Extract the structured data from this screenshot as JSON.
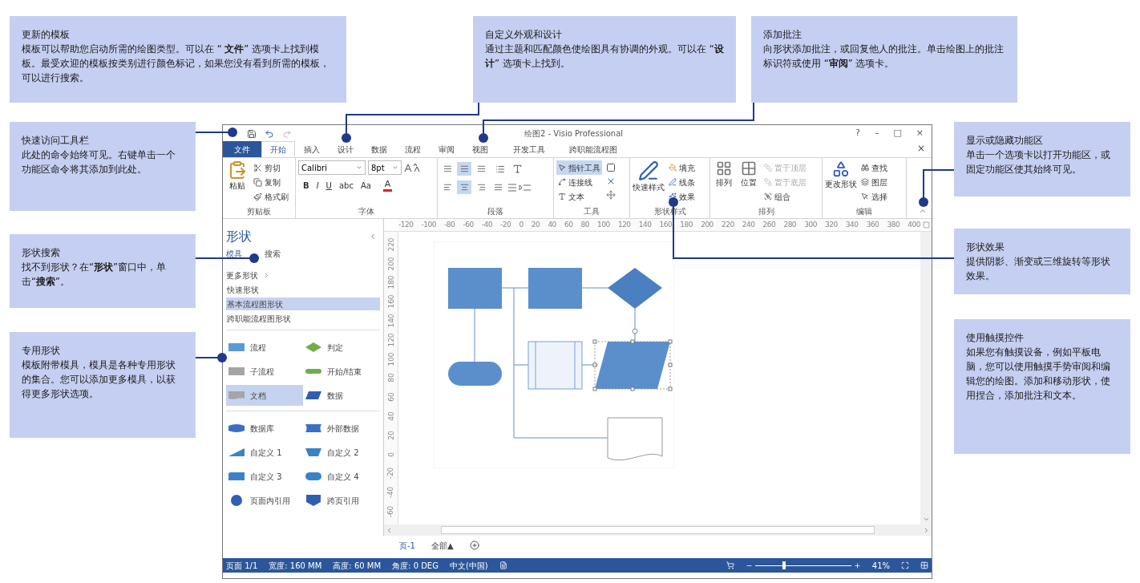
{
  "callouts_top": [
    {
      "title": "更新的模板",
      "body": "模板可以帮助您启动所需的绘图类型。可以在 “ **文件**” 选项卡上找到模板。最受欢迎的模板按类别进行颜色标记，如果您没有看到所需的模板，可以进行搜索。"
    },
    {
      "title": "自定义外观和设计",
      "body": "通过主题和匹配颜色使绘图具有协调的外观。可以在 “**设计**” 选项卡上找到。"
    },
    {
      "title": "添加批注",
      "body": "向形状添加批注，或回复他人的批注。单击绘图上的批注标识符或使用 “**审阅**” 选项卡。"
    }
  ],
  "callouts_left": [
    {
      "title": "快速访问工具栏",
      "body": "此处的命令始终可见。右键单击一个功能区命令将其添加到此处。"
    },
    {
      "title": "形状搜索",
      "body": "找不到形状？在“**形状**”窗口中，单击“**搜索**”。"
    },
    {
      "title": "专用形状",
      "body": "模板附带模具，模具是各种专用形状的集合。您可以添加更多模具，以获得更多形状选项。"
    }
  ],
  "callouts_right": [
    {
      "title": "显示或隐藏功能区",
      "body": "单击一个选项卡以打开功能区，或固定功能区使其始终可见。"
    },
    {
      "title": "形状效果",
      "body": "提供阴影、渐变或三维旋转等形状效果。"
    },
    {
      "title": "使用触摸控件",
      "body": "如果您有触摸设备，例如平板电脑，您可以使用触摸手势审阅和编辑您的绘图。添加和移动形状，使用捏合，添加批注和文本。"
    }
  ],
  "window": {
    "title": "绘图2 - Visio Professional",
    "controls": [
      "?",
      "–",
      "□",
      "×"
    ]
  },
  "ribbon_tabs": [
    {
      "label": "文件",
      "kind": "file",
      "selected": false
    },
    {
      "label": "开始",
      "kind": "tab",
      "selected": true
    },
    {
      "label": "插入",
      "kind": "tab",
      "selected": false
    },
    {
      "label": "设计",
      "kind": "tab",
      "selected": false
    },
    {
      "label": "数据",
      "kind": "tab",
      "selected": false
    },
    {
      "label": "流程",
      "kind": "tab",
      "selected": false
    },
    {
      "label": "审阅",
      "kind": "tab",
      "selected": false
    },
    {
      "label": "视图",
      "kind": "tab",
      "selected": false
    },
    {
      "label": "开发工具",
      "kind": "tab",
      "selected": false
    },
    {
      "label": "跨职能流程图",
      "kind": "tab",
      "selected": false
    }
  ],
  "ribbon_close": "×",
  "ribbon_groups": [
    {
      "kind": "clipboard",
      "label": "剪贴板",
      "paste": "粘贴",
      "items": [
        "剪切",
        "复制",
        "格式刷"
      ]
    },
    {
      "kind": "font",
      "label": "字体",
      "font": "Calibri",
      "size": "8pt",
      "buttons": [
        "B",
        "I",
        "U",
        "abc",
        "Aa"
      ],
      "font_color": "A"
    },
    {
      "kind": "paragraph",
      "label": "段落",
      "valign": [
        {
          "selected": false
        },
        {
          "selected": true
        },
        {
          "selected": false
        }
      ],
      "halign": [
        {
          "selected": false
        },
        {
          "selected": true
        },
        {
          "selected": false
        },
        {
          "selected": false
        }
      ]
    },
    {
      "kind": "tools",
      "label": "工具",
      "items": [
        {
          "label": "指针工具",
          "selected": true
        },
        {
          "label": "连接线",
          "selected": false
        },
        {
          "label": "文本",
          "selected": false
        }
      ]
    },
    {
      "kind": "shape_styles",
      "label": "形状样式",
      "quick": "快速样式",
      "items": [
        "填充",
        "线条",
        "效果"
      ]
    },
    {
      "kind": "arrange",
      "label": "排列",
      "big": [
        "排列",
        "位置"
      ],
      "items": [
        {
          "label": "置于顶层",
          "disabled": true
        },
        {
          "label": "置于底层",
          "disabled": true
        },
        {
          "label": "组合",
          "disabled": false
        }
      ]
    },
    {
      "kind": "editing",
      "label": "编辑",
      "big": "更改形状",
      "items": [
        "查找",
        "图层",
        "选择"
      ]
    }
  ],
  "shapes_panel": {
    "title": "形状",
    "tabs": [
      {
        "label": "模具",
        "selected": true
      },
      {
        "label": "搜索",
        "selected": false
      }
    ],
    "more": "更多形状",
    "stencils": [
      {
        "label": "快速形状",
        "selected": false
      },
      {
        "label": "基本流程图形状",
        "selected": true
      },
      {
        "label": "跨职能流程图形状",
        "selected": false
      }
    ],
    "sections": [
      [
        {
          "label": "流程",
          "kind": "process",
          "color": "#5b9bd5",
          "selected": false
        },
        {
          "label": "判定",
          "kind": "decision",
          "color": "#70ad47",
          "selected": false
        },
        {
          "label": "子流程",
          "kind": "subprocess",
          "color": "#a5a5a5",
          "selected": false
        },
        {
          "label": "开始/结束",
          "kind": "terminator",
          "color": "#70ad47",
          "selected": false
        },
        {
          "label": "文档",
          "kind": "document",
          "color": "#a5a5a5",
          "selected": true
        },
        {
          "label": "数据",
          "kind": "data",
          "color": "#2f5fb3",
          "selected": false
        }
      ],
      [
        {
          "label": "数据库",
          "kind": "database",
          "color": "#3a6fc4",
          "selected": false
        },
        {
          "label": "外部数据",
          "kind": "external",
          "color": "#3a6fc4",
          "selected": false
        },
        {
          "label": "自定义 1",
          "kind": "custom1",
          "color": "#3a82c8",
          "selected": false
        },
        {
          "label": "自定义 2",
          "kind": "custom2",
          "color": "#3a82c8",
          "selected": false
        },
        {
          "label": "自定义 3",
          "kind": "custom3",
          "color": "#3a82c8",
          "selected": false
        },
        {
          "label": "自定义 4",
          "kind": "custom4",
          "color": "#3a82c8",
          "selected": false
        },
        {
          "label": "页面内引用",
          "kind": "onpage",
          "color": "#2f5fb3",
          "selected": false
        },
        {
          "label": "跨页引用",
          "kind": "offpage",
          "color": "#2f5fb3",
          "selected": false
        }
      ]
    ]
  },
  "ruler": {
    "h_ticks": [
      "-120",
      "-100",
      "-80",
      "-60",
      "-40",
      "-20",
      "0",
      "20",
      "40",
      "60",
      "80",
      "100",
      "120",
      "140",
      "160",
      "180",
      "200",
      "220",
      "240",
      "260",
      "280",
      "300",
      "320",
      "340",
      "360",
      "380",
      "400"
    ],
    "v_ticks": [
      "220",
      "200",
      "180",
      "160",
      "140",
      "120",
      "100",
      "80",
      "60",
      "40",
      "20",
      "0",
      "-20",
      "-40",
      "-60"
    ]
  },
  "page_tabs": [
    {
      "label": "页-1",
      "selected": true
    }
  ],
  "all_pages": "全部▲",
  "status_bar": {
    "items": [
      "页面 1/1",
      "宽度: 160 MM",
      "高度: 60 MM",
      "角度: 0 DEG",
      "中文(中国)"
    ],
    "zoom": {
      "level": 0.3,
      "reading": "41%"
    }
  }
}
